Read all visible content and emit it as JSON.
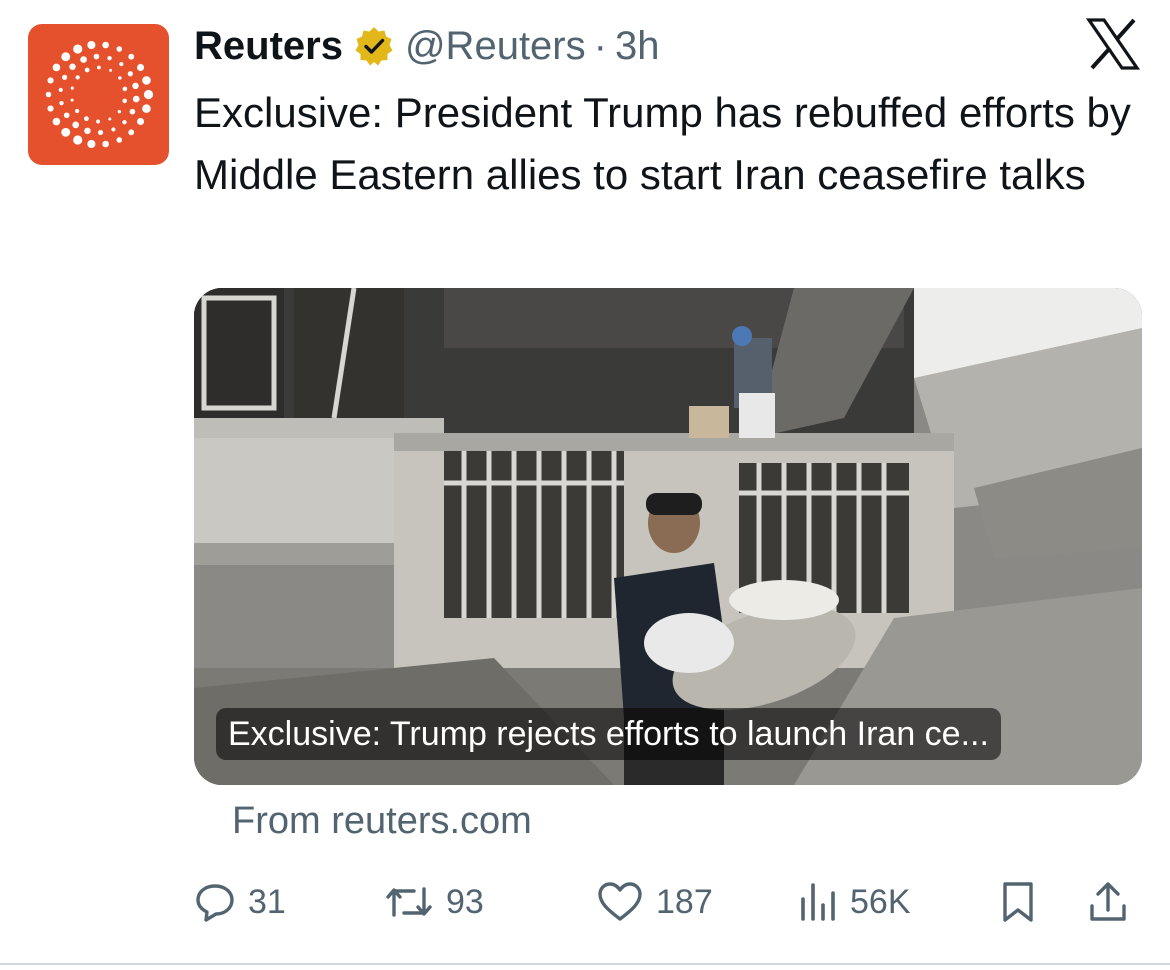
{
  "tweet": {
    "author_name": "Reuters",
    "handle": "@Reuters",
    "separator": "·",
    "time": "3h",
    "text": "Exclusive: President Trump has rebuffed efforts by Middle Eastern allies to start Iran ceasefire talks"
  },
  "card": {
    "title": "Exclusive: Trump rejects efforts to launch Iran ce...",
    "source": "From reuters.com"
  },
  "actions": {
    "replies": "31",
    "reposts": "93",
    "likes": "187",
    "views": "56K"
  },
  "icons": {
    "avatar": "reuters-logo",
    "verified": "verified-badge-icon",
    "platform": "x-logo-icon",
    "reply": "reply-icon",
    "repost": "repost-icon",
    "like": "heart-icon",
    "views": "views-icon",
    "bookmark": "bookmark-icon",
    "share": "share-icon"
  },
  "colors": {
    "brand_avatar": "#e5512d",
    "verified_gold": "#e2b719",
    "secondary_text": "#536471"
  }
}
